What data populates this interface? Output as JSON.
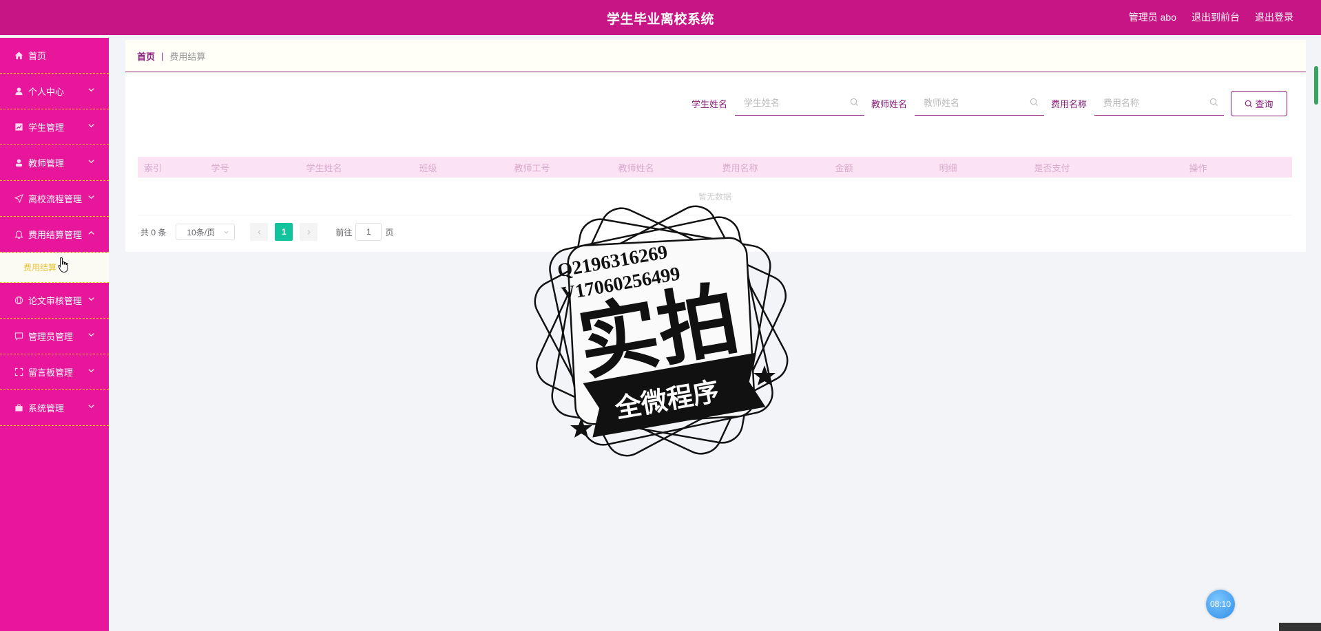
{
  "header": {
    "title": "学生毕业离校系统",
    "user_label": "管理员 abo",
    "front_link": "退出到前台",
    "logout_link": "退出登录"
  },
  "sidebar": {
    "items": [
      {
        "label": "首页",
        "icon": "home-icon"
      },
      {
        "label": "个人中心",
        "icon": "person-icon"
      },
      {
        "label": "学生管理",
        "icon": "chart-icon"
      },
      {
        "label": "教师管理",
        "icon": "user-icon"
      },
      {
        "label": "离校流程管理",
        "icon": "send-icon"
      },
      {
        "label": "费用结算管理",
        "icon": "bell-icon",
        "expanded": true
      },
      {
        "label": "论文审核管理",
        "icon": "globe-icon"
      },
      {
        "label": "管理员管理",
        "icon": "chat-icon"
      },
      {
        "label": "留言板管理",
        "icon": "fullscreen-icon"
      },
      {
        "label": "系统管理",
        "icon": "briefcase-icon"
      }
    ],
    "submenu_label": "费用结算"
  },
  "breadcrumb": {
    "home": "首页",
    "separator": "|",
    "current": "费用结算"
  },
  "search": {
    "student_label": "学生姓名",
    "student_placeholder": "学生姓名",
    "teacher_label": "教师姓名",
    "teacher_placeholder": "教师姓名",
    "fee_label": "费用名称",
    "fee_placeholder": "费用名称",
    "query_button": "查询"
  },
  "table": {
    "columns": [
      "索引",
      "学号",
      "学生姓名",
      "班级",
      "教师工号",
      "教师姓名",
      "费用名称",
      "金额",
      "明细",
      "是否支付",
      "操作"
    ],
    "empty_text": "暂无数据"
  },
  "pagination": {
    "total": "共 0 条",
    "page_size": "10条/页",
    "current_page": "1",
    "goto_prefix": "前往",
    "goto_value": "1",
    "goto_suffix": "页"
  },
  "watermark": {
    "line1": "Q2196316269",
    "line2": "V17060256499",
    "main": "实拍",
    "banner": "全微程序"
  },
  "clock": "08:10",
  "colors": {
    "topbar": "#c71585",
    "sidebar": "#e8169a",
    "accent": "#8b1a7b",
    "page_active": "#13c39e"
  }
}
